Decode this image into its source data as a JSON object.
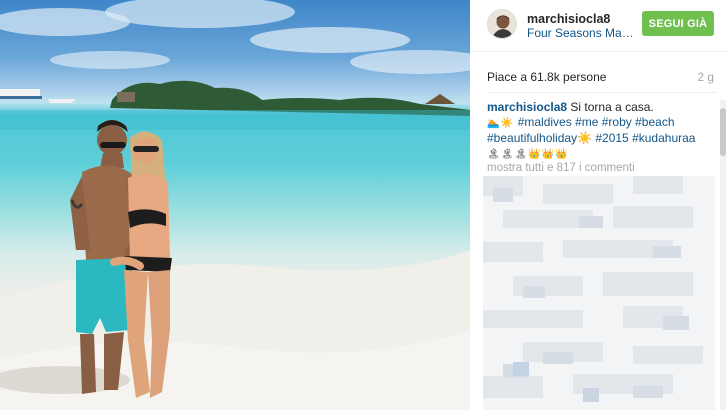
{
  "post": {
    "username": "marchisiocla8",
    "location": "Four Seasons Maldives at Kuda Huraa",
    "follow_label": "SEGUI GIÀ",
    "likes": "Piace a 61.8k persone",
    "time_ago": "2 g",
    "caption": {
      "user": "marchisiocla8",
      "text": "Si torna a casa.",
      "emoji_line1": "🏊☀️ ",
      "hashtags_1": [
        "#maldives",
        "#me",
        "#roby",
        "#beach"
      ],
      "hashtags_2": [
        "#beautifulholiday☀️",
        "#2015",
        "#kudahuraa"
      ],
      "emoji_line2": "🏝🏝🏝👑👑👑"
    },
    "more_comments": "mostra tutti e 817 i commenti"
  },
  "colors": {
    "link": "#125688",
    "follow_button": "#70c050",
    "muted": "#a5a7aa"
  },
  "icons": {
    "avatar": "profile-photo"
  }
}
